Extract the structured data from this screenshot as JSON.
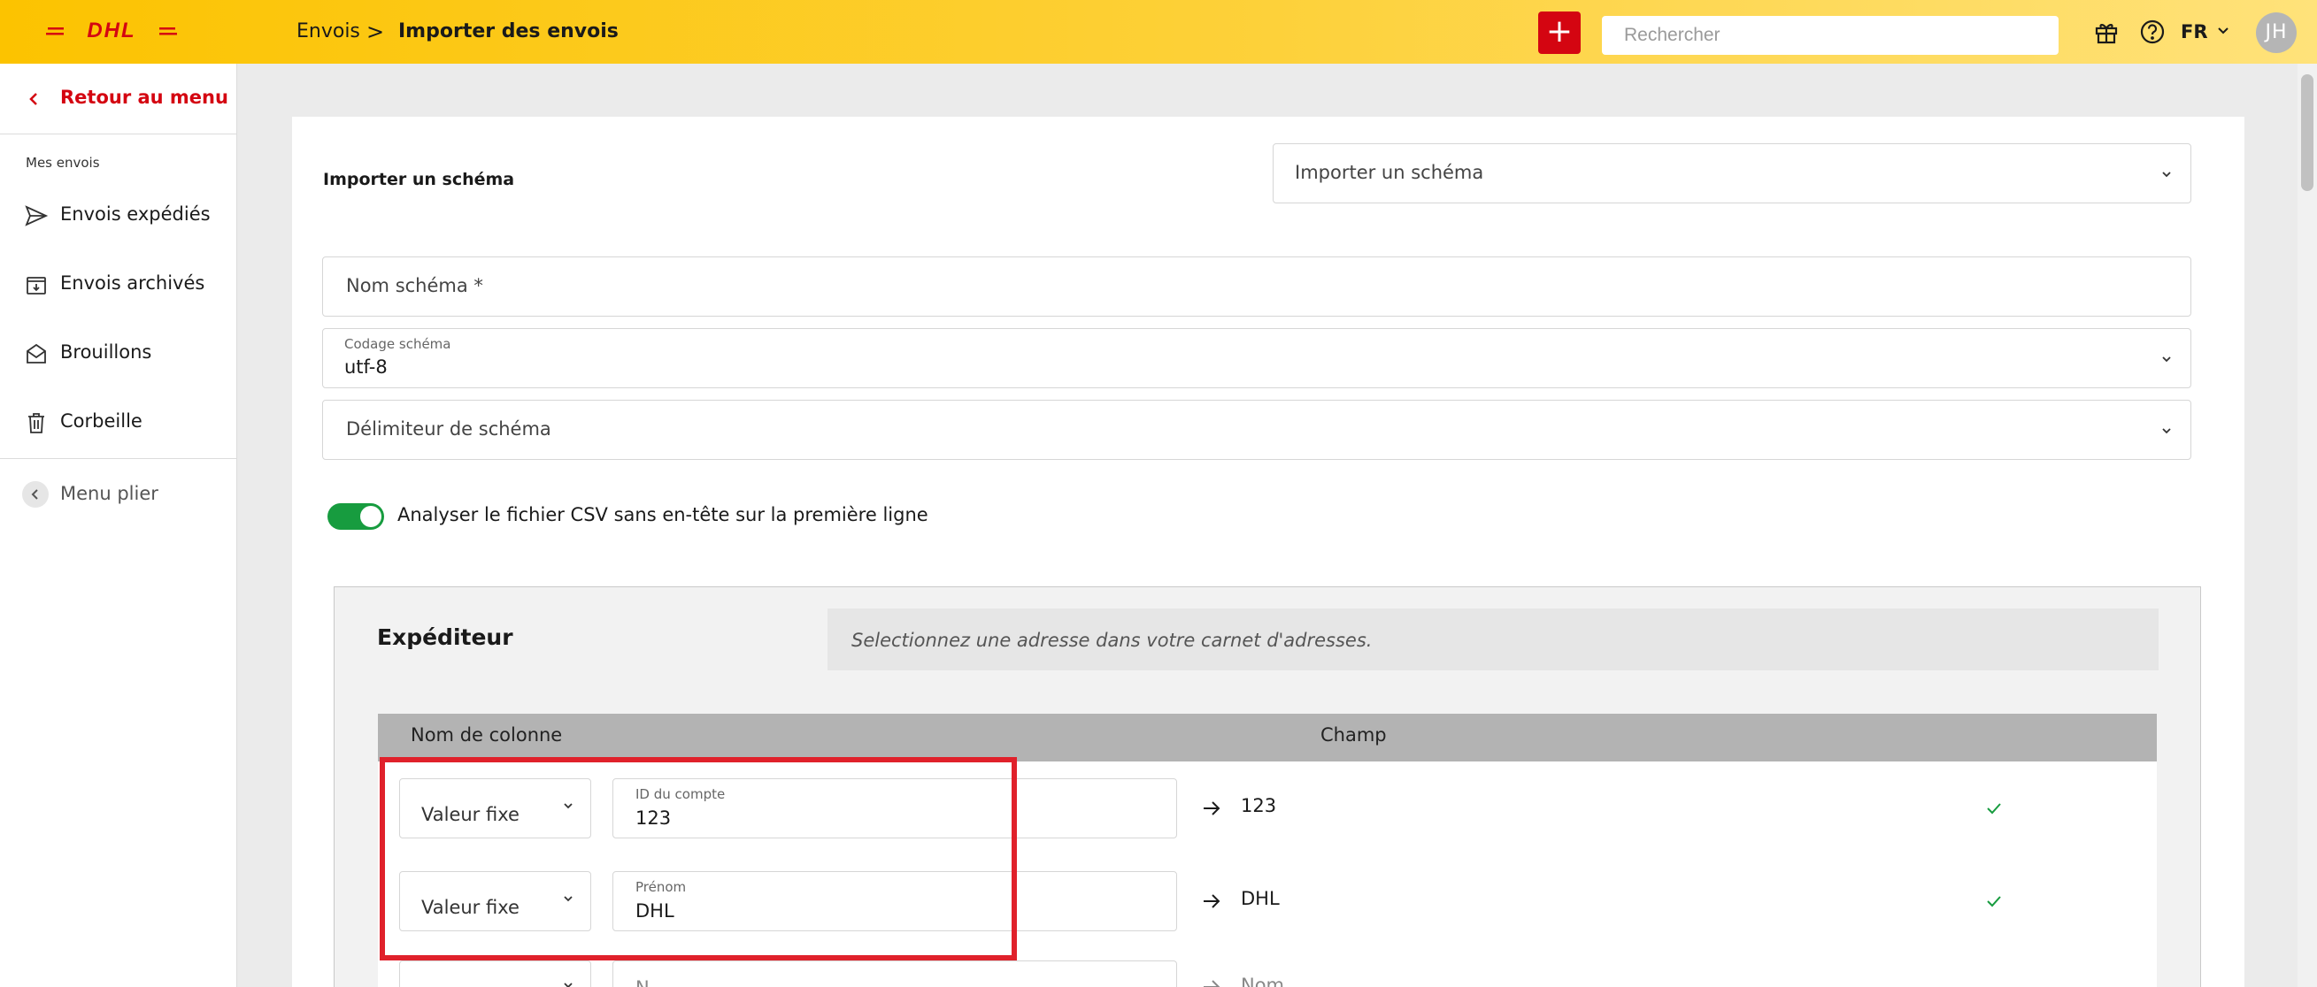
{
  "header": {
    "logo_text": "DHL",
    "breadcrumb": {
      "parent": "Envois",
      "separator": ">",
      "current": "Importer des envois"
    },
    "search": {
      "placeholder": "Rechercher",
      "value": ""
    },
    "language": "FR",
    "avatar_initials": "JH",
    "icons": [
      "plus-icon",
      "gift-icon",
      "help-icon",
      "chevron-down-icon"
    ],
    "colors": {
      "brand_yellow": "#fcc300",
      "brand_red": "#d40511"
    }
  },
  "sidebar": {
    "back_label": "Retour au menu",
    "section_label": "Mes envois",
    "items": [
      {
        "label": "Envois expédiés",
        "icon": "send-icon"
      },
      {
        "label": "Envois archivés",
        "icon": "archive-icon"
      },
      {
        "label": "Brouillons",
        "icon": "draft-icon"
      },
      {
        "label": "Corbeille",
        "icon": "trash-icon"
      }
    ],
    "collapse_label": "Menu plier"
  },
  "form": {
    "import_schema": {
      "label": "Importer un schéma",
      "select_placeholder": "Importer un schéma"
    },
    "schema_name": {
      "placeholder": "Nom schéma *",
      "value": ""
    },
    "schema_encoding": {
      "label": "Codage schéma",
      "value": "utf-8"
    },
    "schema_delimiter": {
      "placeholder": "Délimiteur de schéma"
    },
    "csv_toggle": {
      "label": "Analyser le fichier CSV sans en-tête sur la première ligne",
      "checked": true
    }
  },
  "sender": {
    "title": "Expéditeur",
    "address_placeholder": "Selectionnez une adresse dans votre carnet d'adresses.",
    "table": {
      "headers": [
        "Nom de colonne",
        "Champ"
      ],
      "rows": [
        {
          "type": "Valeur fixe",
          "field_label": "ID du compte",
          "field_value": "123",
          "result": "123",
          "valid": true
        },
        {
          "type": "Valeur fixe",
          "field_label": "Prénom",
          "field_value": "DHL",
          "result": "DHL",
          "valid": true
        },
        {
          "type": "",
          "field_label": "N...",
          "field_value": "",
          "result": "Nom",
          "valid": false
        }
      ]
    }
  }
}
